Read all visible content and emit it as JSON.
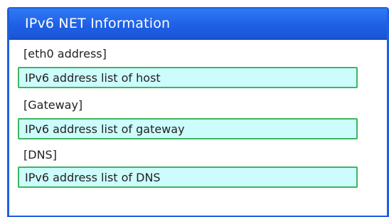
{
  "window": {
    "title": "IPv6 NET Information"
  },
  "sections": [
    {
      "label": "[eth0 address]",
      "value": "IPv6 address list of host"
    },
    {
      "label": "[Gateway]",
      "value": "IPv6 address list of gateway"
    },
    {
      "label": "[DNS]",
      "value": "IPv6 address list of DNS"
    }
  ],
  "colors": {
    "titlebar": "#1f60e6",
    "field_background": "#ccfcfc",
    "field_border": "#3fb560"
  }
}
